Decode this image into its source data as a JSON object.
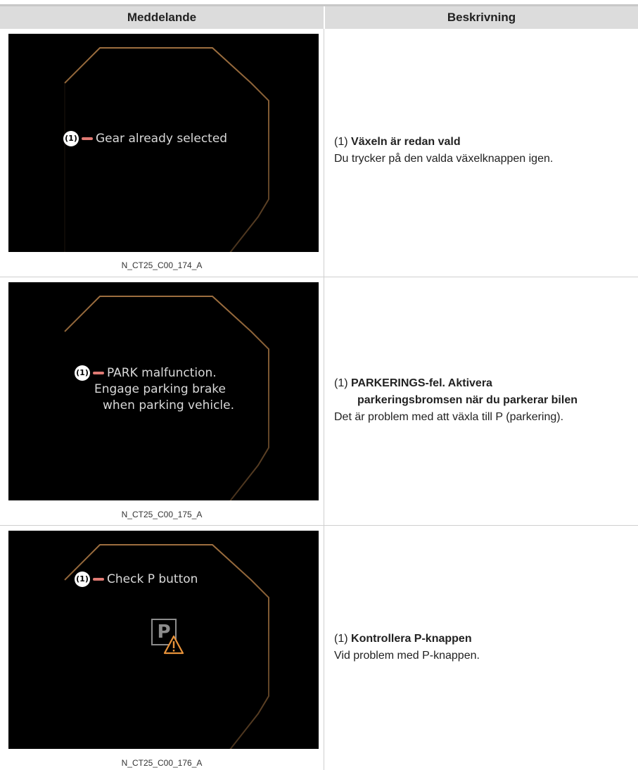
{
  "header": {
    "col1": "Meddelande",
    "col2": "Beskrivning"
  },
  "rows": [
    {
      "screen": {
        "badge": "(1)",
        "lines": [
          "Gear already selected"
        ]
      },
      "caption": "N_CT25_C00_174_A",
      "desc": {
        "num": "(1)",
        "title": "Växeln är redan vald",
        "title_line2": "",
        "body": "Du trycker på den valda växelknappen igen."
      }
    },
    {
      "screen": {
        "badge": "(1)",
        "lines": [
          "PARK malfunction.",
          "Engage parking brake",
          "when parking vehicle."
        ]
      },
      "caption": "N_CT25_C00_175_A",
      "desc": {
        "num": "(1)",
        "title": "PARKERINGS-fel. Aktivera",
        "title_line2": "parkeringsbromsen när du parkerar bilen",
        "body": "Det är problem med att växla till P (parkering)."
      }
    },
    {
      "screen": {
        "badge": "(1)",
        "lines": [
          "Check P button"
        ],
        "p_symbol": "P",
        "warning_icon": "warning-triangle-icon"
      },
      "caption": "N_CT25_C00_176_A",
      "desc": {
        "num": "(1)",
        "title": "Kontrollera P-knappen",
        "title_line2": "",
        "body": "Vid problem med P-knappen."
      }
    }
  ],
  "colors": {
    "header_bg": "#dcdcdc",
    "screen_bg": "#000000",
    "frame_stroke": "#b9824a",
    "callout_dash": "#e07a73",
    "warning": "#e8933a"
  }
}
